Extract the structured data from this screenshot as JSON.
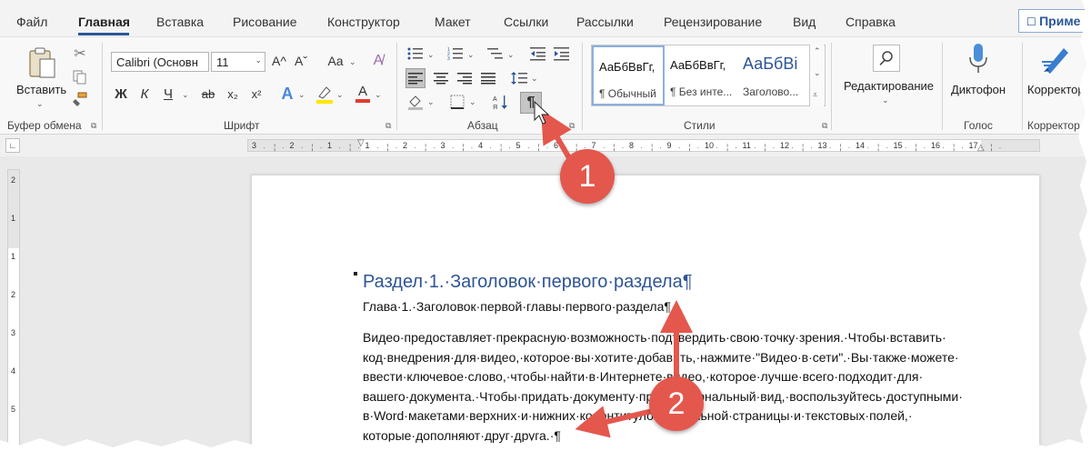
{
  "tabs": [
    "Файл",
    "Главная",
    "Вставка",
    "Рисование",
    "Конструктор",
    "Макет",
    "Ссылки",
    "Рассылки",
    "Рецензирование",
    "Вид",
    "Справка"
  ],
  "help_button": "Приме",
  "clipboard": {
    "paste_label": "Вставить",
    "group_label": "Буфер обмена"
  },
  "font": {
    "name": "Calibri (Основн",
    "size": "11",
    "group_label": "Шрифт",
    "bold": "Ж",
    "italic": "К",
    "underline": "Ч",
    "strike": "ab",
    "subscript": "x₂",
    "superscript": "x²",
    "grow": "A^",
    "shrink": "Aˇ",
    "case": "Aa",
    "text_effects": "A",
    "font_color": "A"
  },
  "paragraph": {
    "group_label": "Абзац",
    "show_marks": "¶"
  },
  "styles": {
    "group_label": "Стили",
    "items": [
      {
        "sample": "АаБбВвГг,",
        "name": "¶ Обычный"
      },
      {
        "sample": "АаБбВвГг,",
        "name": "¶ Без инте..."
      },
      {
        "sample": "АаБбВі",
        "name": "Заголово..."
      }
    ]
  },
  "editing": {
    "label": "Редактирование"
  },
  "voice": {
    "label": "Диктофон",
    "group_label": "Голос"
  },
  "editor": {
    "label": "Корректор",
    "group_label": "Корректор"
  },
  "ruler": {
    "numbers": [
      "3",
      "2",
      "1",
      "1",
      "2",
      "3",
      "4",
      "5",
      "6",
      "7",
      "8",
      "9",
      "10",
      "11",
      "12",
      "13",
      "14",
      "15",
      "16",
      "17"
    ]
  },
  "vruler": {
    "numbers": [
      "2",
      "1",
      "1",
      "2",
      "3",
      "4",
      "5"
    ]
  },
  "document": {
    "heading1": "Раздел·1.·Заголовок·первого·раздела¶",
    "heading2": "Глава·1.·Заголовок·первой·главы·первого·раздела¶",
    "body_lines": [
      "Видео·предоставляет·прекрасную·возможность·подтвердить·свою·точку·зрения.·Чтобы·вставить·",
      "код·внедрения·для·видео,·которое·вы·хотите·добавить,·нажмите·\"Видео·в·сети\".·Вы·также·можете·",
      "ввести·ключевое·слово,·чтобы·найти·в·Интернете·видео,·которое·лучше·всего·подходит·для·",
      "вашего·документа.·Чтобы·придать·документу·профессиональный·вид,·воспользуйтесь·доступными·",
      "в·Word·макетами·верхних·и·нижних·колонтитулов,·титульной·страницы·и·текстовых·полей,·",
      "которые·дополняют·друг·друга.·¶"
    ]
  },
  "annotations": {
    "callout_1": "1",
    "callout_2": "2"
  },
  "colors": {
    "accent": "#2b579a",
    "heading": "#2f5496",
    "callout": "#e4574d"
  }
}
